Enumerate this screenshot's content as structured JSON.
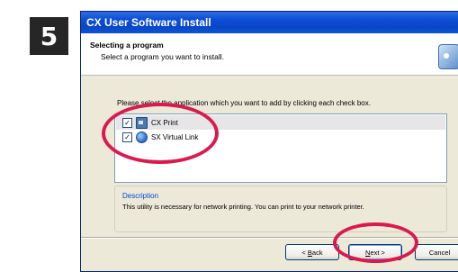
{
  "step": {
    "number": "5"
  },
  "window": {
    "title": "CX User Software Install"
  },
  "header": {
    "title": "Selecting a program",
    "subtitle": "Select a program you want to install."
  },
  "instruction": "Please select the application which you want to add by clicking each check box.",
  "apps": [
    {
      "label": "CX Print",
      "checked": true,
      "icon": "printer-icon"
    },
    {
      "label": "SX Virtual Link",
      "checked": true,
      "icon": "globe-link-icon"
    }
  ],
  "description": {
    "title": "Description",
    "text": "This utility is necessary for network printing. You can print to your network printer."
  },
  "buttons": {
    "back_prefix": "< ",
    "back_key": "B",
    "back_rest": "ack",
    "next_key": "N",
    "next_rest": "ext >",
    "cancel": "Cancel"
  },
  "colors": {
    "highlight": "#d91a4f",
    "titlebar": "#0a46c4",
    "description_title": "#0046d5"
  }
}
